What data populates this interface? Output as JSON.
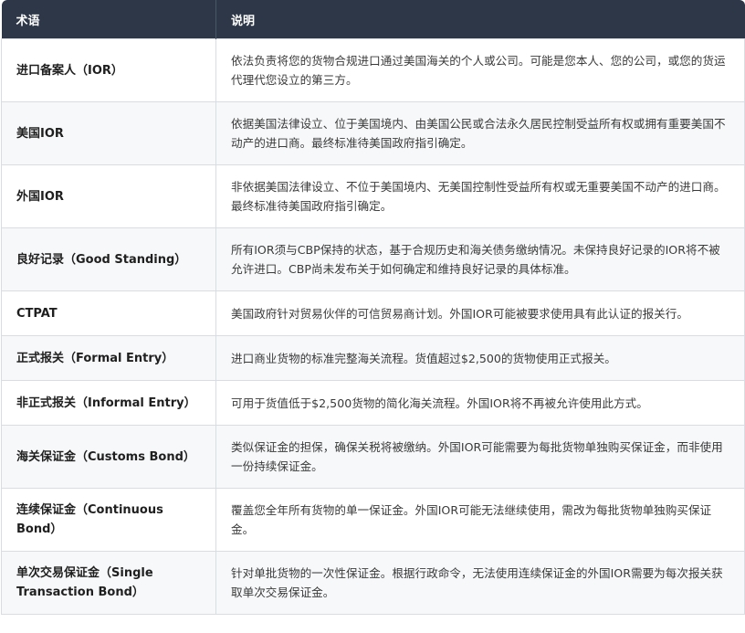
{
  "table": {
    "headers": [
      "术语",
      "说明"
    ],
    "rows": [
      {
        "term": "进口备案人（IOR）",
        "desc": "依法负责将您的货物合规进口通过美国海关的个人或公司。可能是您本人、您的公司，或您的货运代理代您设立的第三方。"
      },
      {
        "term": "美国IOR",
        "desc": "依据美国法律设立、位于美国境内、由美国公民或合法永久居民控制受益所有权或拥有重要美国不动产的进口商。最终标准待美国政府指引确定。"
      },
      {
        "term": "外国IOR",
        "desc": "非依据美国法律设立、不位于美国境内、无美国控制性受益所有权或无重要美国不动产的进口商。最终标准待美国政府指引确定。"
      },
      {
        "term": "良好记录（Good Standing）",
        "desc": "所有IOR须与CBP保持的状态，基于合规历史和海关债务缴纳情况。未保持良好记录的IOR将不被允许进口。CBP尚未发布关于如何确定和维持良好记录的具体标准。"
      },
      {
        "term": "CTPAT",
        "desc": "美国政府针对贸易伙伴的可信贸易商计划。外国IOR可能被要求使用具有此认证的报关行。"
      },
      {
        "term": "正式报关（Formal Entry）",
        "desc": "进口商业货物的标准完整海关流程。货值超过$2,500的货物使用正式报关。"
      },
      {
        "term": "非正式报关（Informal Entry）",
        "desc": "可用于货值低于$2,500货物的简化海关流程。外国IOR将不再被允许使用此方式。"
      },
      {
        "term": "海关保证金（Customs Bond）",
        "desc": "类似保证金的担保，确保关税将被缴纳。外国IOR可能需要为每批货物单独购买保证金，而非使用一份持续保证金。"
      },
      {
        "term": "连续保证金（Continuous Bond）",
        "desc": "覆盖您全年所有货物的单一保证金。外国IOR可能无法继续使用，需改为每批货物单独购买保证金。"
      },
      {
        "term": "单次交易保证金（Single Transaction Bond）",
        "desc": "针对单批货物的一次性保证金。根据行政命令，无法使用连续保证金的外国IOR需要为每次报关获取单次交易保证金。"
      }
    ]
  }
}
